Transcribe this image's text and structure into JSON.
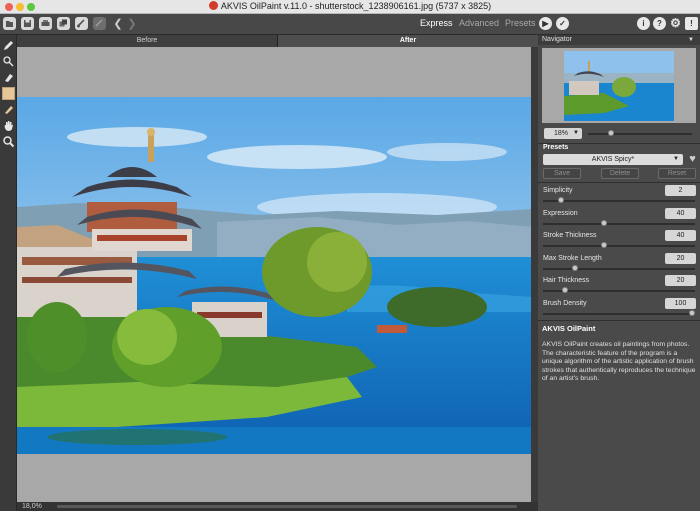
{
  "window": {
    "title": "AKVIS OilPaint v.11.0 - shutterstock_1238906161.jpg (5737 x 3825)",
    "traffic_colors": [
      "#ee5f56",
      "#f7bd30",
      "#5cc73f"
    ]
  },
  "toolbar": {
    "modes": [
      "Express",
      "Advanced",
      "Presets"
    ],
    "active_mode": "Express",
    "left_icons": [
      "open-icon",
      "save-icon",
      "print-icon",
      "batch-icon",
      "share-icon",
      "preferences-icon",
      "undo-icon",
      "redo-icon"
    ],
    "right_icons": [
      "run-icon",
      "apply-icon",
      "info-icon",
      "help-icon",
      "settings-icon",
      "notifications-icon"
    ]
  },
  "tools": [
    "brush-icon",
    "stroke-direction-icon",
    "eraser-icon",
    "color-swatch",
    "restore-icon",
    "hand-icon",
    "zoom-icon"
  ],
  "canvas": {
    "tabs": [
      "Before",
      "After"
    ],
    "active_tab": "After",
    "zoom_status": "18,0%"
  },
  "panel": {
    "navigator": {
      "title": "Navigator",
      "zoom": "18%",
      "zoom_slider_fraction": 0.33
    },
    "presets": {
      "title": "Presets",
      "selected": "AKVIS Spicy*",
      "buttons": [
        "Save",
        "Delete",
        "Reset"
      ]
    },
    "parameters": [
      {
        "name": "Simplicity",
        "value": "2",
        "fraction": 0.1
      },
      {
        "name": "Expression",
        "value": "40",
        "fraction": 0.4
      },
      {
        "name": "Stroke Thickness",
        "value": "40",
        "fraction": 0.4
      },
      {
        "name": "Max Stroke Length",
        "value": "20",
        "fraction": 0.2
      },
      {
        "name": "Hair Thickness",
        "value": "20",
        "fraction": 0.13
      },
      {
        "name": "Brush Density",
        "value": "100",
        "fraction": 1.0
      }
    ],
    "description": {
      "title": "AKVIS OilPaint",
      "text": "AKVIS OilPaint creates oil paintings from photos. The characteristic feature of the program is a unique algorithm of the artistic application of brush strokes that authentically reproduces the technique of an artist's brush."
    }
  }
}
